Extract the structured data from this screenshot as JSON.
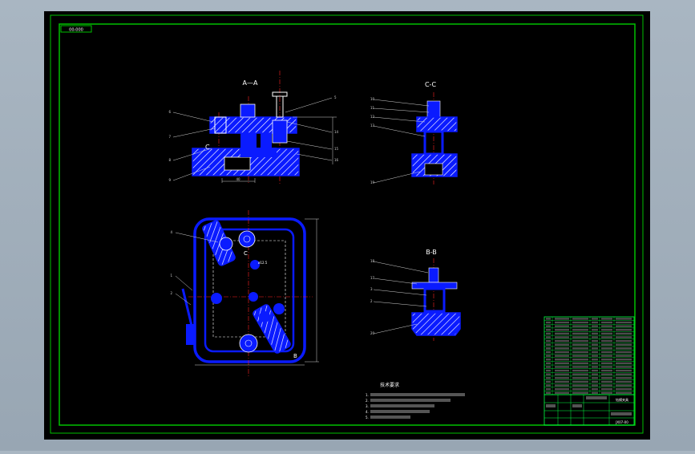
{
  "sheet": {
    "top_left_tag": "00-000",
    "colors": {
      "background": "#000000",
      "outer_frame": "#00c000",
      "inner_frame": "#00c000",
      "part": "#0a1bff",
      "hatch": "#ffffff",
      "center_line": "#ff2020",
      "dimension": "#d0d0d0",
      "table_line": "#00ff40"
    }
  },
  "views": {
    "aa": {
      "label": "A—A",
      "dim_bottom": "40",
      "callouts_left": [
        "6",
        "7",
        "8",
        "9"
      ],
      "callouts_right": [
        "5",
        "14",
        "15",
        "16"
      ]
    },
    "cc": {
      "label": "C-C",
      "callouts_left": [
        "10",
        "11",
        "12",
        "13",
        "19"
      ]
    },
    "bb": {
      "label": "B-B",
      "callouts_left": [
        "18",
        "17",
        "3",
        "2",
        "20"
      ]
    },
    "plan": {
      "callouts_left": [
        "4",
        "1",
        "2"
      ],
      "letter_b": "B",
      "letter_c": "C",
      "note_small": "ø12.5"
    }
  },
  "notes": {
    "title": "技术要求",
    "lines": [
      "1.",
      "2.",
      "3.",
      "4.",
      "5."
    ]
  },
  "title_block": {
    "drawing_title": "钻模夹具",
    "drawing_number": "JX07-00"
  }
}
